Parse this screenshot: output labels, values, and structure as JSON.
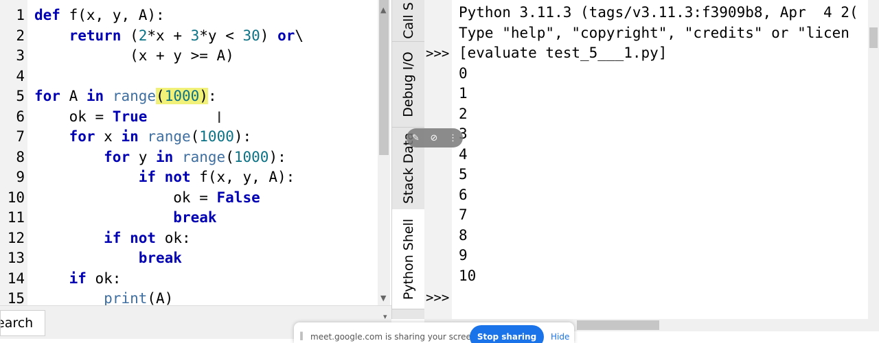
{
  "editor": {
    "line_numbers": [
      "1",
      "2",
      "3",
      "4",
      "5",
      "6",
      "7",
      "8",
      "9",
      "10",
      "11",
      "12",
      "13",
      "14",
      "15"
    ],
    "lines": [
      "def f(x, y, A):",
      "    return (2*x + 3*y < 30) or\\",
      "           (x + y >= A)",
      "",
      "for A in range(1000):",
      "    ok = True",
      "    for x in range(1000):",
      "        for y in range(1000):",
      "            if not f(x, y, A):",
      "                ok = False",
      "                break",
      "        if not ok:",
      "            break",
      "    if ok:",
      "        print(A)"
    ]
  },
  "search_tab": {
    "label": "earch"
  },
  "side_tabs": [
    "Call S",
    "Debug I/O",
    "Stack Data",
    "Python Shell"
  ],
  "shell": {
    "lines": [
      "Python 3.11.3 (tags/v3.11.3:f3909b8, Apr  4 2(",
      "Type \"help\", \"copyright\", \"credits\" or \"licen",
      "[evaluate test_5___1.py]",
      "0",
      "1",
      "2",
      "3",
      "4",
      "5",
      "6",
      "7",
      "8",
      "9",
      "10"
    ],
    "prompt": ">>>"
  },
  "share_bar": {
    "text": "meet.google.com is sharing your screen.",
    "stop_label": "Stop sharing",
    "hide_label": "Hide"
  },
  "colors": {
    "keyword": "#0000b3",
    "number": "#0b7285",
    "builtin": "#3f6fa0",
    "highlight": "#f1f17a",
    "button": "#1a73e8"
  }
}
